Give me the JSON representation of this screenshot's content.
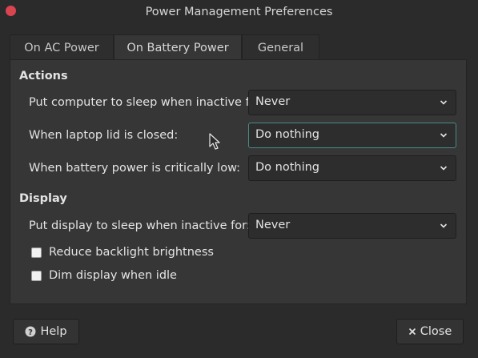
{
  "window": {
    "title": "Power Management Preferences"
  },
  "tabs": [
    {
      "label": "On AC Power",
      "active": false
    },
    {
      "label": "On Battery Power",
      "active": true
    },
    {
      "label": "General",
      "active": false
    }
  ],
  "actions": {
    "heading": "Actions",
    "sleep": {
      "label": "Put computer to sleep when inactive for:",
      "value": "Never"
    },
    "lid": {
      "label": "When laptop lid is closed:",
      "value": "Do nothing"
    },
    "critical": {
      "label": "When battery power is critically low:",
      "value": "Do nothing"
    }
  },
  "display": {
    "heading": "Display",
    "sleep": {
      "label": "Put display to sleep when inactive for:",
      "value": "Never"
    },
    "reduce_backlight": {
      "label": "Reduce backlight brightness",
      "checked": false
    },
    "dim_idle": {
      "label": "Dim display when idle",
      "checked": false
    }
  },
  "buttons": {
    "help": "Help",
    "close": "Close"
  },
  "colors": {
    "background": "#2b2b2b",
    "panel": "#363636",
    "close_dot": "#d94451",
    "focus": "#4a8a86"
  },
  "icons": {
    "help": "help-circle-icon",
    "close": "x-icon",
    "dropdown": "chevron-down-icon"
  }
}
